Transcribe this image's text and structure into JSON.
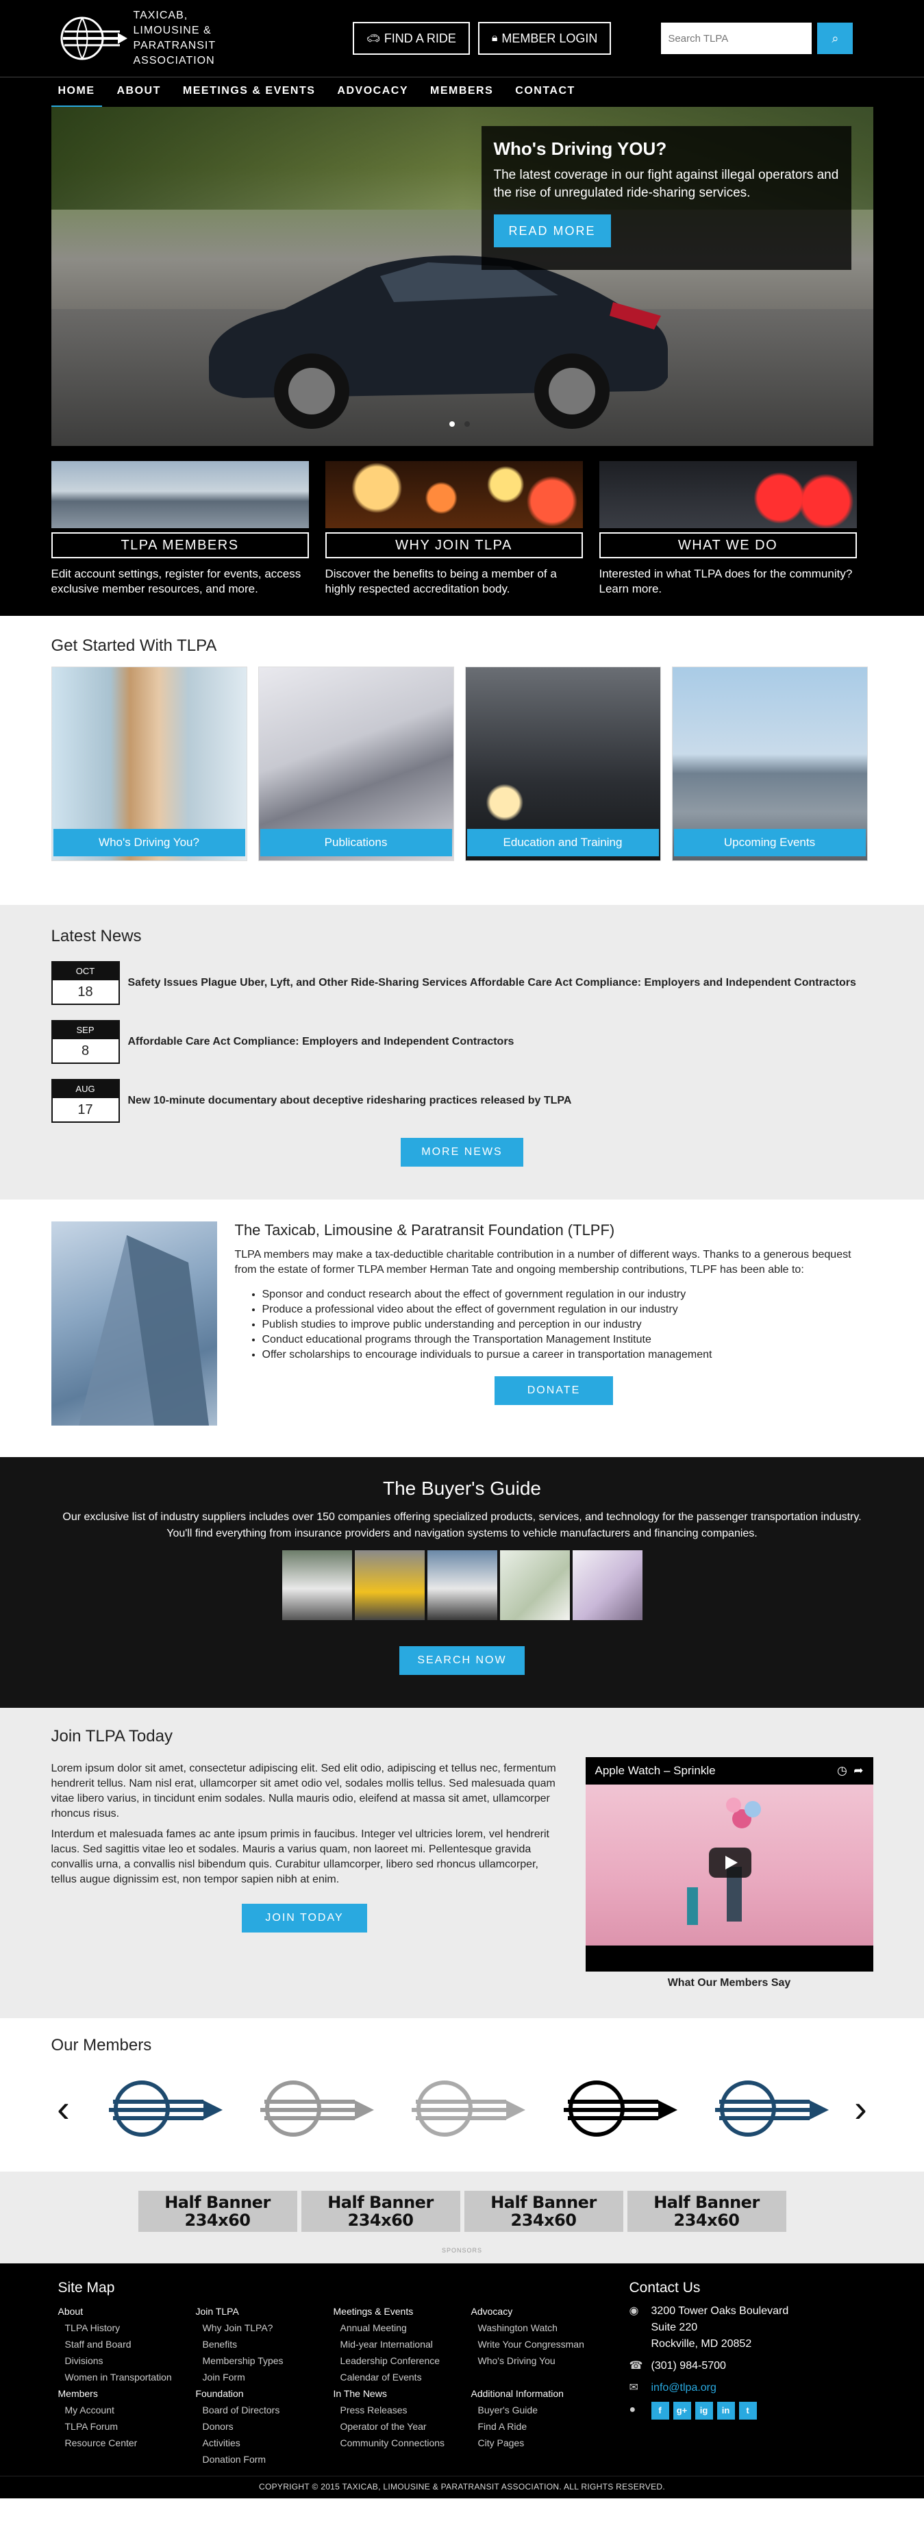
{
  "header": {
    "logo_lines": [
      "TAXICAB,",
      "LIMOUSINE &",
      "PARATRANSIT",
      "ASSOCIATION"
    ],
    "find_ride": "FIND A RIDE",
    "member_login": "MEMBER LOGIN",
    "search_placeholder": "Search TLPA"
  },
  "nav": [
    "HOME",
    "ABOUT",
    "MEETINGS & EVENTS",
    "ADVOCACY",
    "MEMBERS",
    "CONTACT"
  ],
  "hero": {
    "title": "Who's Driving YOU?",
    "text": "The latest coverage in our fight against illegal operators and the rise of unregulated ride-sharing services.",
    "button": "READ MORE"
  },
  "tiles": [
    {
      "label": "TLPA MEMBERS",
      "text": "Edit account settings, register for events, access exclusive member resources, and more."
    },
    {
      "label": "WHY JOIN TLPA",
      "text": "Discover the benefits to being a member of a highly respected accreditation body."
    },
    {
      "label": "WHAT WE DO",
      "text": "Interested in what TLPA does for the community? Learn more."
    }
  ],
  "get_started": {
    "title": "Get Started With TLPA",
    "cards": [
      "Who's Driving You?",
      "Publications",
      "Education and Training",
      "Upcoming Events"
    ]
  },
  "news": {
    "title": "Latest News",
    "items": [
      {
        "month": "OCT",
        "day": "18",
        "title": "Safety Issues Plague Uber, Lyft, and Other Ride-Sharing Services Affordable Care Act Compliance: Employers and Independent Contractors"
      },
      {
        "month": "SEP",
        "day": "8",
        "title": "Affordable Care Act Compliance: Employers and Independent Contractors"
      },
      {
        "month": "AUG",
        "day": "17",
        "title": "New 10-minute documentary about deceptive ridesharing practices released by TLPA"
      }
    ],
    "button": "MORE NEWS"
  },
  "foundation": {
    "title": "The Taxicab, Limousine & Paratransit Foundation (TLPF)",
    "text": "TLPA members may make a tax-deductible charitable contribution in a number of different ways. Thanks to a generous bequest from the estate of former TLPA member Herman Tate and ongoing membership contributions, TLPF has been able to:",
    "bullets": [
      "Sponsor and conduct research about the effect of government regulation in our industry",
      "Produce a professional video about the effect of government regulation in our industry",
      "Publish studies to improve public understanding and perception in our industry",
      "Conduct educational programs through the Transportation Management Institute",
      "Offer scholarships to encourage individuals to pursue a career in transportation management"
    ],
    "button": "DONATE"
  },
  "buyers": {
    "title": "The Buyer's Guide",
    "text": "Our exclusive list of industry suppliers includes over 150 companies offering specialized products, services, and technology for the passenger transportation industry. You'll find everything from insurance providers and navigation systems to vehicle manufacturers and financing companies.",
    "button": "SEARCH NOW"
  },
  "join": {
    "title": "Join TLPA Today",
    "p1": "Lorem ipsum dolor sit amet, consectetur adipiscing elit. Sed elit odio, adipiscing et tellus nec, fermentum hendrerit tellus. Nam nisl erat, ullamcorper sit amet odio vel, sodales mollis tellus. Sed malesuada quam vitae libero varius, in tincidunt enim sodales. Nulla mauris odio, eleifend at massa sit amet, ullamcorper rhoncus risus.",
    "p2": "Interdum et malesuada fames ac ante ipsum primis in faucibus. Integer vel ultricies lorem, vel hendrerit lacus. Sed sagittis vitae leo et sodales. Mauris a varius quam, non laoreet mi. Pellentesque gravida convallis urna, a convallis nisl bibendum quis. Curabitur ullamcorper, libero sed rhoncus ullamcorper, tellus augue dignissim est, non tempor sapien nibh at enim.",
    "button": "JOIN TODAY",
    "video_title": "Apple Watch – Sprinkle",
    "video_caption": "What Our Members Say"
  },
  "members": {
    "title": "Our Members"
  },
  "sponsors": {
    "banners": [
      {
        "line1": "Half Banner",
        "line2": "234x60"
      },
      {
        "line1": "Half Banner",
        "line2": "234x60"
      },
      {
        "line1": "Half Banner",
        "line2": "234x60"
      },
      {
        "line1": "Half Banner",
        "line2": "234x60"
      }
    ],
    "label": "SPONSORS"
  },
  "footer": {
    "sitemap_title": "Site Map",
    "cols": [
      [
        {
          "h": "About"
        },
        {
          "i": "TLPA History"
        },
        {
          "i": "Staff and Board"
        },
        {
          "i": "Divisions"
        },
        {
          "i": "Women in Transportation"
        },
        {
          "h": "Members"
        },
        {
          "i": "My Account"
        },
        {
          "i": "TLPA Forum"
        },
        {
          "i": "Resource Center"
        }
      ],
      [
        {
          "h": "Join TLPA"
        },
        {
          "i": "Why Join TLPA?"
        },
        {
          "i": "Benefits"
        },
        {
          "i": "Membership Types"
        },
        {
          "i": "Join Form"
        },
        {
          "h": "Foundation"
        },
        {
          "i": "Board of Directors"
        },
        {
          "i": "Donors"
        },
        {
          "i": "Activities"
        },
        {
          "i": "Donation Form"
        }
      ],
      [
        {
          "h": "Meetings & Events"
        },
        {
          "i": "Annual Meeting"
        },
        {
          "i": "Mid-year International"
        },
        {
          "i": "Leadership Conference"
        },
        {
          "i": "Calendar of Events"
        },
        {
          "h": "In The News"
        },
        {
          "i": "Press Releases"
        },
        {
          "i": "Operator of the Year"
        },
        {
          "i": "Community Connections"
        }
      ],
      [
        {
          "h": "Advocacy"
        },
        {
          "i": "Washington Watch"
        },
        {
          "i": "Write Your Congressman"
        },
        {
          "i": "Who's Driving You"
        },
        {
          "h": ""
        },
        {
          "h": "Additional Information"
        },
        {
          "i": "Buyer's Guide"
        },
        {
          "i": "Find A Ride"
        },
        {
          "i": "City Pages"
        }
      ]
    ],
    "contact_title": "Contact Us",
    "address": [
      "3200 Tower Oaks Boulevard",
      "Suite 220",
      "Rockville, MD 20852"
    ],
    "phone": "(301) 984-5700",
    "email": "info@tlpa.org",
    "social": [
      "f",
      "g+",
      "ig",
      "in",
      "t"
    ],
    "copyright": "COPYRIGHT © 2015 TAXICAB, LIMOUSINE & PARATRANSIT ASSOCIATION. ALL RIGHTS RESERVED."
  },
  "colors": {
    "accent": "#29a9e0",
    "dark": "#000000",
    "light_band": "#ececec"
  }
}
